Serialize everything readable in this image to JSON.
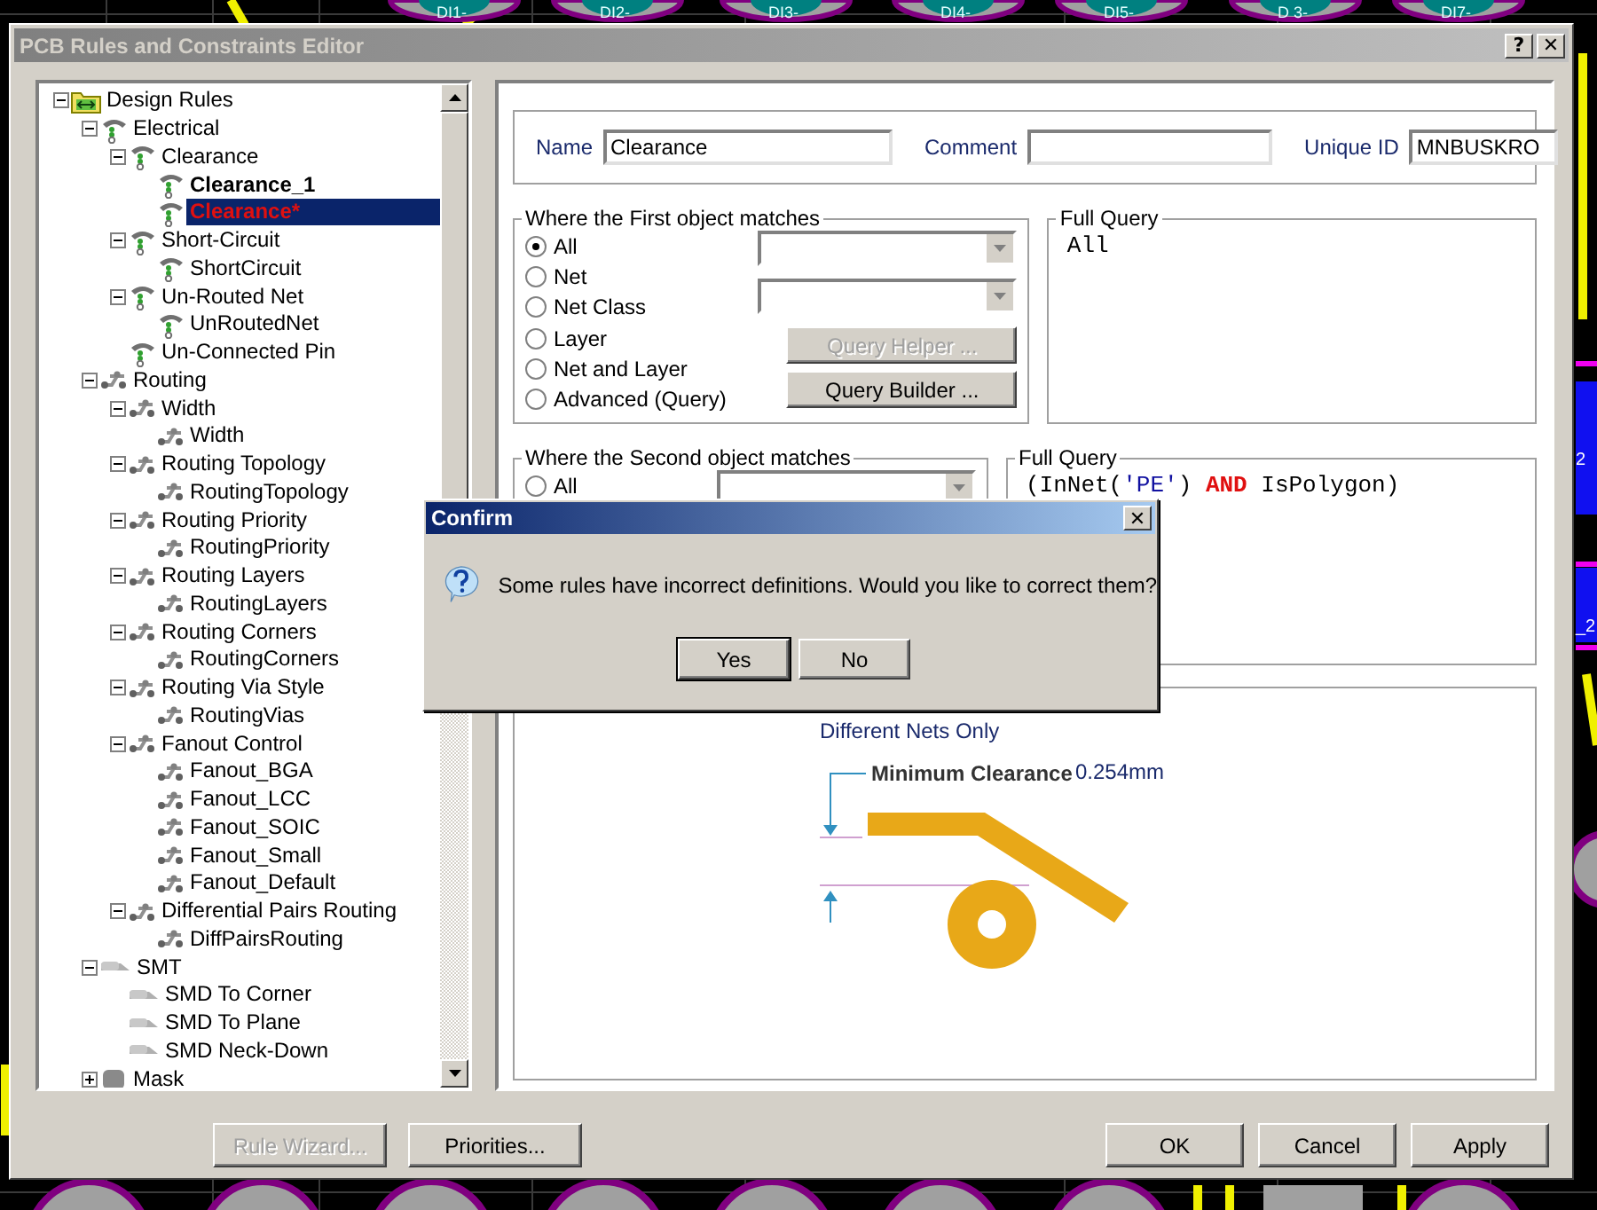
{
  "pcb": {
    "pad_labels": [
      "DI1-",
      "DI2-",
      "DI3-",
      "DI4-",
      "DI5-",
      "D 3-",
      "DI7-"
    ],
    "side_labels": [
      "2",
      "_2"
    ]
  },
  "window": {
    "title": "PCB Rules and Constraints Editor",
    "help": "?",
    "close": "✕"
  },
  "tree": {
    "items": [
      {
        "label": "Design Rules",
        "kind": "folder",
        "selected": false,
        "expanded": true,
        "children": [
          {
            "label": "Electrical",
            "kind": "electrical",
            "selected": false,
            "expanded": true,
            "children": [
              {
                "label": "Clearance",
                "kind": "electrical",
                "selected": false,
                "expanded": true,
                "children": [
                  {
                    "label": "Clearance_1",
                    "kind": "electrical",
                    "selected": false,
                    "bold": true,
                    "invalid": false
                  },
                  {
                    "label": "Clearance*",
                    "kind": "electrical",
                    "selected": true,
                    "bold": true,
                    "invalid": true
                  }
                ]
              },
              {
                "label": "Short-Circuit",
                "kind": "electrical",
                "selected": false,
                "expanded": true,
                "children": [
                  {
                    "label": "ShortCircuit",
                    "kind": "electrical",
                    "selected": false
                  }
                ]
              },
              {
                "label": "Un-Routed Net",
                "kind": "electrical",
                "selected": false,
                "expanded": true,
                "children": [
                  {
                    "label": "UnRoutedNet",
                    "kind": "electrical",
                    "selected": false
                  }
                ]
              },
              {
                "label": "Un-Connected Pin",
                "kind": "electrical",
                "selected": false
              }
            ]
          },
          {
            "label": "Routing",
            "kind": "routing",
            "selected": false,
            "expanded": true,
            "children": [
              {
                "label": "Width",
                "kind": "routing",
                "selected": false,
                "expanded": true,
                "children": [
                  {
                    "label": "Width",
                    "kind": "routing",
                    "selected": false
                  }
                ]
              },
              {
                "label": "Routing Topology",
                "kind": "routing",
                "selected": false,
                "expanded": true,
                "children": [
                  {
                    "label": "RoutingTopology",
                    "kind": "routing",
                    "selected": false
                  }
                ]
              },
              {
                "label": "Routing Priority",
                "kind": "routing",
                "selected": false,
                "expanded": true,
                "children": [
                  {
                    "label": "RoutingPriority",
                    "kind": "routing",
                    "selected": false
                  }
                ]
              },
              {
                "label": "Routing Layers",
                "kind": "routing",
                "selected": false,
                "expanded": true,
                "children": [
                  {
                    "label": "RoutingLayers",
                    "kind": "routing",
                    "selected": false
                  }
                ]
              },
              {
                "label": "Routing Corners",
                "kind": "routing",
                "selected": false,
                "expanded": true,
                "children": [
                  {
                    "label": "RoutingCorners",
                    "kind": "routing",
                    "selected": false
                  }
                ]
              },
              {
                "label": "Routing Via Style",
                "kind": "routing",
                "selected": false,
                "expanded": true,
                "children": [
                  {
                    "label": "RoutingVias",
                    "kind": "routing",
                    "selected": false
                  }
                ]
              },
              {
                "label": "Fanout Control",
                "kind": "routing",
                "selected": false,
                "expanded": true,
                "children": [
                  {
                    "label": "Fanout_BGA",
                    "kind": "routing",
                    "selected": false
                  },
                  {
                    "label": "Fanout_LCC",
                    "kind": "routing",
                    "selected": false
                  },
                  {
                    "label": "Fanout_SOIC",
                    "kind": "routing",
                    "selected": false
                  },
                  {
                    "label": "Fanout_Small",
                    "kind": "routing",
                    "selected": false
                  },
                  {
                    "label": "Fanout_Default",
                    "kind": "routing",
                    "selected": false
                  }
                ]
              },
              {
                "label": "Differential Pairs Routing",
                "kind": "routing",
                "selected": false,
                "expanded": true,
                "children": [
                  {
                    "label": "DiffPairsRouting",
                    "kind": "routing",
                    "selected": false
                  }
                ]
              }
            ]
          },
          {
            "label": "SMT",
            "kind": "smt",
            "selected": false,
            "expanded": true,
            "children": [
              {
                "label": "SMD To Corner",
                "kind": "smt",
                "selected": false
              },
              {
                "label": "SMD To Plane",
                "kind": "smt",
                "selected": false
              },
              {
                "label": "SMD Neck-Down",
                "kind": "smt",
                "selected": false
              }
            ]
          },
          {
            "label": "Mask",
            "kind": "mask",
            "selected": false,
            "expanded": false
          }
        ]
      }
    ]
  },
  "fields": [
    {
      "label": "Name",
      "value": "Clearance"
    },
    {
      "label": "Comment"
    },
    {
      "label": "Unique ID",
      "value": "MNBUSKRO"
    }
  ],
  "first_match": {
    "title": "Where the First object matches",
    "options": [
      {
        "label": "All",
        "selected": true
      },
      {
        "label": "Net",
        "selected": false
      },
      {
        "label": "Net Class",
        "selected": false
      },
      {
        "label": "Layer",
        "selected": false
      },
      {
        "label": "Net and Layer",
        "selected": false
      },
      {
        "label": "Advanced (Query)",
        "selected": false
      }
    ],
    "buttons": [
      {
        "label": "Query Helper ...",
        "disabled": true
      },
      {
        "label": "Query Builder ...",
        "disabled": false
      }
    ]
  },
  "first_query": {
    "title": "Full Query",
    "tokens": [
      {
        "text": "All",
        "kind": "plain"
      }
    ]
  },
  "second_match": {
    "title": "Where the Second object matches",
    "options": [
      {
        "label": "All",
        "selected": false
      }
    ]
  },
  "second_query": {
    "title": "Full Query",
    "tokens": [
      {
        "text": "(InNet(",
        "kind": "plain"
      },
      {
        "text": "'PE'",
        "kind": "string"
      },
      {
        "text": ") ",
        "kind": "plain"
      },
      {
        "text": "AND",
        "kind": "keyword"
      },
      {
        "text": " IsPolygon)",
        "kind": "plain"
      }
    ]
  },
  "constraint": {
    "scope": "Different Nets Only",
    "label": "Minimum Clearance",
    "value": "0.254mm"
  },
  "buttons": [
    {
      "label": "Rule Wizard...",
      "disabled": true
    },
    {
      "label": "Priorities...",
      "disabled": false
    },
    {
      "label": "OK",
      "disabled": false
    },
    {
      "label": "Cancel",
      "disabled": false
    },
    {
      "label": "Apply",
      "disabled": false
    }
  ],
  "confirm": {
    "title": "Confirm",
    "close": "✕",
    "message": "Some rules have incorrect definitions. Would you like to correct them?",
    "buttons": [
      {
        "label": "Yes",
        "default": true
      },
      {
        "label": "No",
        "default": false
      }
    ]
  }
}
